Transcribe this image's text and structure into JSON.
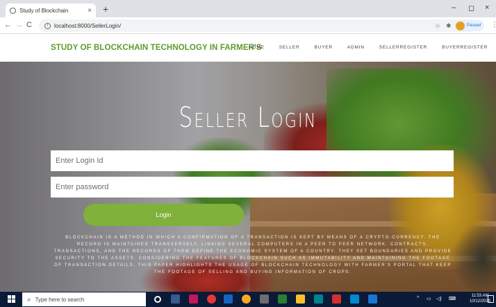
{
  "browser": {
    "tab_title": "Study of Blockchain",
    "tab_close": "×",
    "new_tab": "+",
    "url": "localhost:8000/SellerLogin/",
    "profile_status": "Paused",
    "window_controls": {
      "minimize": "–",
      "maximize": "◻",
      "close": "×"
    }
  },
  "site": {
    "brand": "STUDY OF BLOCKCHAIN TECHNOLOGY IN FARMER'S",
    "nav": [
      "HOME",
      "SELLER",
      "BUYER",
      "ADMIN",
      "SELLERREGISTER",
      "BUYERREGISTER"
    ]
  },
  "hero": {
    "title": "Seller Login",
    "login_placeholder": "Enter Login Id",
    "password_placeholder": "Enter password",
    "login_button": "Login",
    "description": "Blockchain is a method in which a confirmation of a transaction is kept by means of a crypto-currency. The record is maintained transversely, linking several computers in a peer to peer network. Contracts, transactions, and the records of them define the economic system of a country. They set boundaries and provide security to the assets. Considering the features of blockchain such as immutability and maintaining the footage of transaction details, this paper highlights the usage of blockchain technology with farmer's portal that keep the footage of selling and buying information of crops."
  },
  "taskbar": {
    "search_placeholder": "Type here to search",
    "time": "11:53 AM",
    "date": "10/12/2020"
  },
  "colors": {
    "brand_green": "#5e9a2c",
    "button_green": "#7fb13b",
    "taskbar": "#0b1a36"
  }
}
